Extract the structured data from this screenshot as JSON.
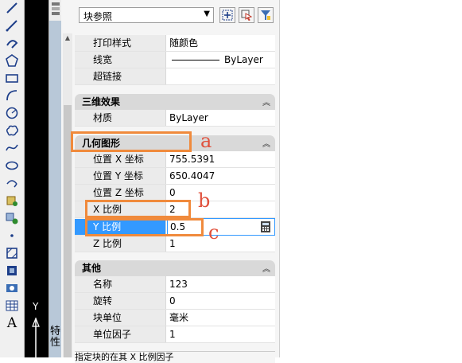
{
  "block_selector": {
    "value": "块参照"
  },
  "properties": {
    "top_rows": [
      {
        "name": "打印样式",
        "value": "随颜色"
      },
      {
        "name": "线宽",
        "value": "ByLayer"
      },
      {
        "name": "超链接",
        "value": ""
      }
    ],
    "categories": {
      "three_d": {
        "title": "三维效果",
        "rows": [
          {
            "name": "材质",
            "value": "ByLayer"
          }
        ]
      },
      "geometry": {
        "title": "几何图形",
        "rows": [
          {
            "name": "位置 X 坐标",
            "value": "755.5391"
          },
          {
            "name": "位置 Y 坐标",
            "value": "650.4047"
          },
          {
            "name": "位置 Z 坐标",
            "value": "0"
          },
          {
            "name": "X 比例",
            "value": "2"
          },
          {
            "name": "Y 比例",
            "value": "0.5"
          },
          {
            "name": "Z 比例",
            "value": "1"
          }
        ]
      },
      "other": {
        "title": "其他",
        "rows": [
          {
            "name": "名称",
            "value": "123"
          },
          {
            "name": "旋转",
            "value": "0"
          },
          {
            "name": "块单位",
            "value": "毫米"
          },
          {
            "name": "单位因子",
            "value": "1"
          }
        ]
      }
    },
    "description": "指定块的在其 X 比例因子"
  },
  "side_tab": {
    "label": "特性"
  },
  "ucs": {
    "axis_label": "Y"
  },
  "annotations": {
    "a": "a",
    "b": "b",
    "c": "c"
  },
  "colors": {
    "selection": "#3399ff",
    "annotation_box": "#f08a3c",
    "annotation_text": "#e0503c"
  },
  "icons": [
    "line-icon",
    "polyline-icon",
    "polygon-icon",
    "rectangle-icon",
    "arc-icon",
    "circle-icon",
    "revcloud-icon",
    "spline-icon",
    "ellipse-icon",
    "insert-block-icon",
    "point-icon",
    "hatch-icon",
    "table-icon",
    "text-icon",
    "quick-select-icon",
    "select-objects-icon",
    "toggle-pickadd-icon",
    "calculator-icon"
  ]
}
